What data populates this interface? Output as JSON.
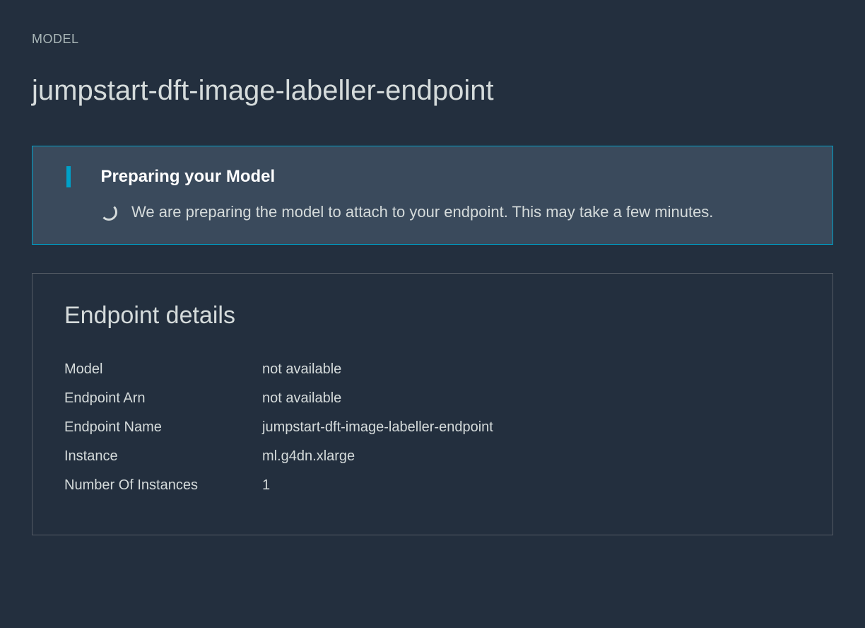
{
  "breadcrumb": "MODEL",
  "page_title": "jumpstart-dft-image-labeller-endpoint",
  "status_panel": {
    "title": "Preparing your Model",
    "message": "We are preparing the model to attach to your endpoint. This may take a few minutes."
  },
  "endpoint_details": {
    "title": "Endpoint details",
    "rows": [
      {
        "label": "Model",
        "value": "not available"
      },
      {
        "label": "Endpoint Arn",
        "value": "not available"
      },
      {
        "label": "Endpoint Name",
        "value": "jumpstart-dft-image-labeller-endpoint"
      },
      {
        "label": "Instance",
        "value": "ml.g4dn.xlarge"
      },
      {
        "label": "Number Of Instances",
        "value": "1"
      }
    ]
  }
}
